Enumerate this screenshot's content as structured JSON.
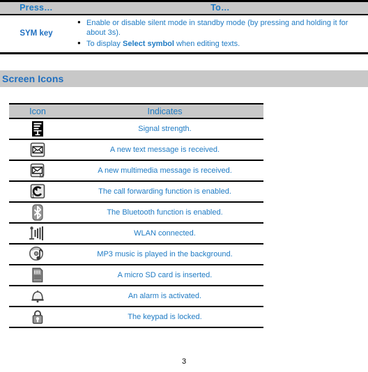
{
  "keys_table": {
    "headers": {
      "press": "Press…",
      "to": "To…"
    },
    "rows": [
      {
        "key": "SYM key",
        "bullets": [
          {
            "pre": "Enable or disable silent mode in standby mode (by pressing and holding it for about 3s).",
            "bold": "",
            "post": ""
          },
          {
            "pre": "To display ",
            "bold": "Select symbol",
            "post": " when editing texts."
          }
        ]
      }
    ]
  },
  "section": {
    "title": "Screen Icons"
  },
  "icons_table": {
    "headers": {
      "icon": "Icon",
      "indicates": "Indicates"
    },
    "rows": [
      {
        "icon_name": "signal-strength-icon",
        "indicates": "Signal strength."
      },
      {
        "icon_name": "new-text-message-icon",
        "indicates": "A new text message is received."
      },
      {
        "icon_name": "new-multimedia-message-icon",
        "indicates": "A new multimedia message is received."
      },
      {
        "icon_name": "call-forwarding-icon",
        "indicates": "The call forwarding function is enabled."
      },
      {
        "icon_name": "bluetooth-icon",
        "indicates": "The Bluetooth function is enabled."
      },
      {
        "icon_name": "wlan-connected-icon",
        "indicates": "WLAN connected."
      },
      {
        "icon_name": "mp3-playing-icon",
        "indicates": "MP3 music is played in the background."
      },
      {
        "icon_name": "micro-sd-card-icon",
        "indicates": "A micro SD card is inserted."
      },
      {
        "icon_name": "alarm-icon",
        "indicates": "An alarm is activated."
      },
      {
        "icon_name": "keypad-lock-icon",
        "indicates": "The keypad is locked."
      }
    ]
  },
  "footer": {
    "page_number": "3"
  },
  "colors": {
    "text_blue": "#1f7bc4",
    "heading_blue": "#1f6fc0",
    "header_gray": "#c8c8c8",
    "rule_black": "#000000"
  }
}
